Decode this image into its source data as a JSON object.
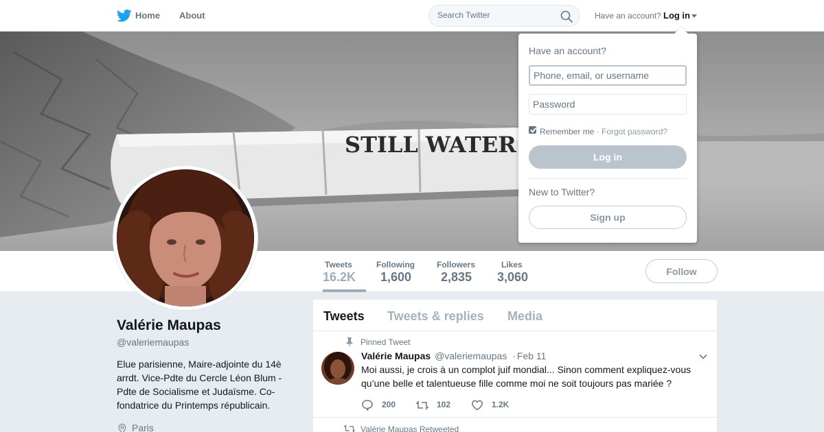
{
  "nav": {
    "logo_icon": "twitter-bird-icon",
    "home_label": "Home",
    "about_label": "About",
    "search_placeholder": "Search Twitter",
    "have_account_text": "Have an account?",
    "login_label": "Log in"
  },
  "banner": {
    "sign_text": "STILL WATER"
  },
  "profile": {
    "name": "Valérie Maupas",
    "handle": "@valeriemaupas",
    "bio": "Elue parisienne, Maire-adjointe du 14è arrdt. Vice-Pdte du Cercle Léon Blum - Pdte de Socialisme et Judaïsme. Co-fondatrice du Printemps républicain.",
    "location": "Paris",
    "follow_label": "Follow"
  },
  "stats": [
    {
      "label": "Tweets",
      "value": "16.2K"
    },
    {
      "label": "Following",
      "value": "1,600"
    },
    {
      "label": "Followers",
      "value": "2,835"
    },
    {
      "label": "Likes",
      "value": "3,060"
    }
  ],
  "timeline": {
    "tabs": [
      "Tweets",
      "Tweets & replies",
      "Media"
    ],
    "pinned_label": "Pinned Tweet",
    "tweet": {
      "name": "Valérie Maupas",
      "handle": "@valeriemaupas",
      "separator": "·",
      "date": "Feb 11",
      "text": "Moi aussi, je crois à un complot juif mondial... Sinon comment expliquez-vous qu’une belle et talentueuse fille comme moi ne soit toujours pas mariée ?",
      "replies": "200",
      "retweets": "102",
      "likes": "1.2K"
    },
    "retweeted_label": "Valérie Maupas Retweeted"
  },
  "login_dropdown": {
    "title": "Have an account?",
    "username_placeholder": "Phone, email, or username",
    "password_placeholder": "Password",
    "remember_label": "Remember me",
    "separator": "·",
    "forgot_label": "Forgot password?",
    "remember_checked": true,
    "login_button": "Log in",
    "new_text": "New to Twitter?",
    "signup_button": "Sign up"
  },
  "colors": {
    "twitter_blue": "#1da1f2",
    "text_primary": "#14171a",
    "text_secondary": "#657786",
    "page_bg": "#e6ecf0",
    "disabled_button": "#b9c4cd"
  }
}
